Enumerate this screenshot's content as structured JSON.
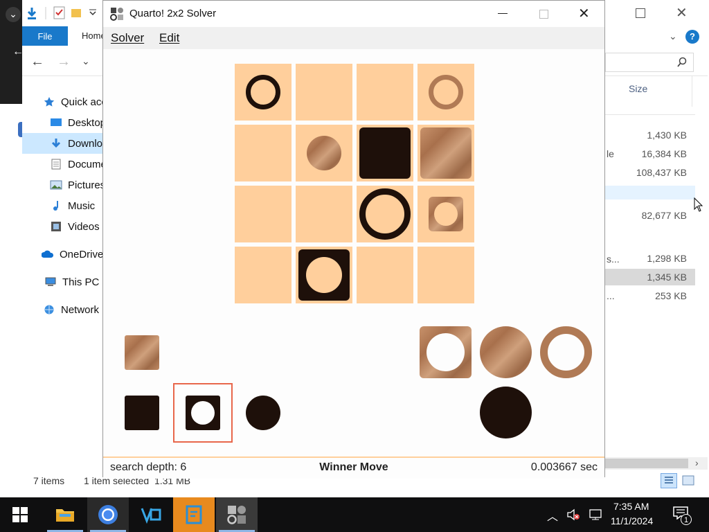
{
  "explorer": {
    "ribbon_tabs": {
      "file": "File",
      "home": "Home"
    },
    "nav": [
      {
        "label": "Quick acc",
        "icon": "star-icon"
      },
      {
        "label": "Desktop",
        "icon": "desktop-icon"
      },
      {
        "label": "Downlo",
        "icon": "download-icon"
      },
      {
        "label": "Docume",
        "icon": "document-icon"
      },
      {
        "label": "Pictures",
        "icon": "pictures-icon"
      },
      {
        "label": "Music",
        "icon": "music-icon"
      },
      {
        "label": "Videos",
        "icon": "videos-icon"
      },
      {
        "label": "OneDrive",
        "icon": "cloud-icon"
      },
      {
        "label": "This PC",
        "icon": "pc-icon"
      },
      {
        "label": "Network",
        "icon": "network-icon"
      }
    ],
    "column_header": "Size",
    "partial_labels": {
      "row2": "le",
      "row6": "s...",
      "row8": "..."
    },
    "sizes": [
      "1,430 KB",
      "16,384 KB",
      "108,437 KB",
      "82,677 KB",
      "1,298 KB",
      "1,345 KB",
      "253 KB"
    ],
    "status": {
      "items": "7 items",
      "selected": "1 item selected  1.31 MB"
    }
  },
  "quarto": {
    "title": "Quarto! 2x2 Solver",
    "menu": {
      "solver": "Solver",
      "edit": "Edit"
    },
    "status": {
      "depth": "search depth: 6",
      "message": "Winner Move",
      "time": "0.003667 sec"
    }
  },
  "taskbar": {
    "time": "7:35 AM",
    "date": "11/1/2024",
    "notification_count": "1"
  },
  "colors": {
    "board": "#ffcf9c",
    "dark_piece": "#1e100a",
    "wood": "#b07a55",
    "accent": "#1979ca",
    "highlight": "#e8664a"
  }
}
